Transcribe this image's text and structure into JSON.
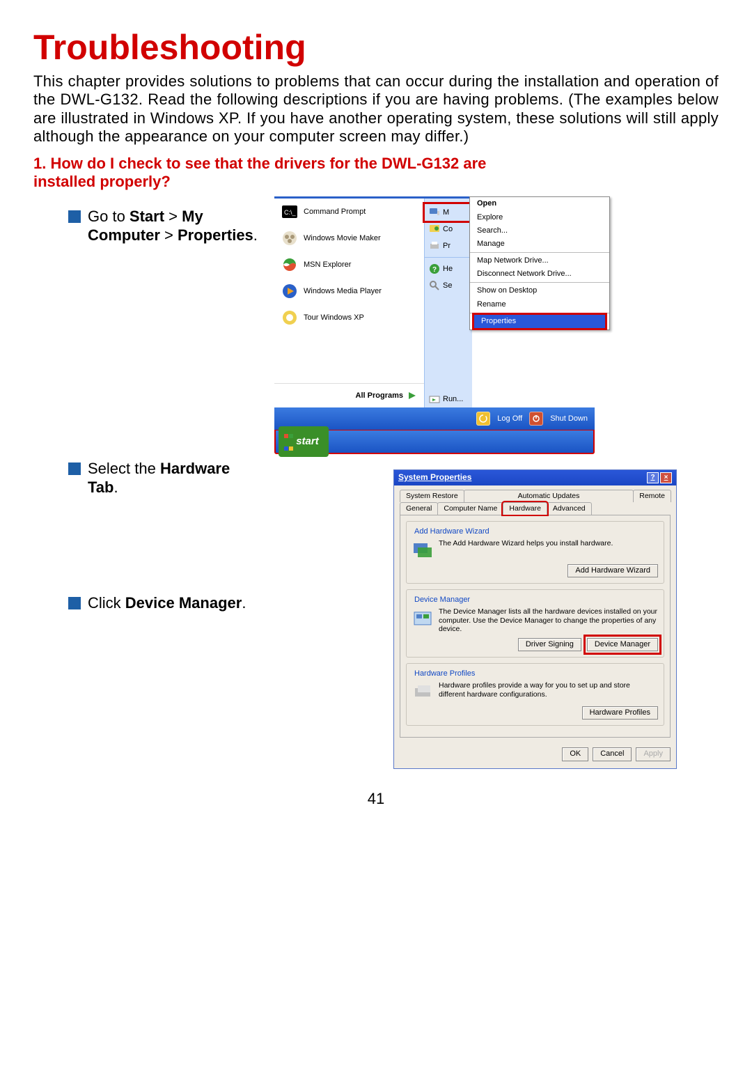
{
  "title": "Troubleshooting",
  "intro": "This chapter provides solutions to problems that can occur during the installation and operation of the DWL-G132. Read the following descriptions if you are having problems. (The examples below are illustrated in Windows XP. If you have another operating system, these solutions will still apply although the appearance on your computer screen may differ.)",
  "question1": "1.  How do I check to see that the drivers for the DWL-G132 are installed properly?",
  "step1_pre": "Go to ",
  "step1_b1": "Start",
  "step1_gt1": " > ",
  "step1_b2": "My Computer",
  "step1_gt2": " > ",
  "step1_b3": "Properties",
  "step1_post": ".",
  "step2_pre": "Select the ",
  "step2_b": "Hardware Tab",
  "step2_post": ".",
  "step3_pre": "Click  ",
  "step3_b": "Device Manager",
  "step3_post": ".",
  "start_menu": {
    "left": [
      "Command Prompt",
      "Windows Movie Maker",
      "MSN Explorer",
      "Windows Media Player",
      "Tour Windows XP"
    ],
    "all_programs": "All Programs",
    "right_short": [
      "M",
      "Co",
      "Pr",
      "He",
      "Se"
    ],
    "right_full_first": "My Computer",
    "run": "Run...",
    "logoff": "Log Off",
    "shutdown": "Shut Down",
    "start": "start"
  },
  "context_menu": {
    "items": [
      "Open",
      "Explore",
      "Search...",
      "Manage",
      "Map Network Drive...",
      "Disconnect Network Drive...",
      "Show on Desktop",
      "Rename",
      "Properties"
    ]
  },
  "sysprop": {
    "title": "System Properties",
    "tabs_row1": [
      "System Restore",
      "Automatic Updates",
      "Remote"
    ],
    "tabs_row2": [
      "General",
      "Computer Name",
      "Hardware",
      "Advanced"
    ],
    "g1_title": "Add Hardware Wizard",
    "g1_text": "The Add Hardware Wizard helps you install hardware.",
    "g1_btn": "Add Hardware Wizard",
    "g2_title": "Device Manager",
    "g2_text": "The Device Manager lists all the hardware devices installed on your computer. Use the Device Manager to change the properties of any device.",
    "g2_btn1": "Driver Signing",
    "g2_btn2": "Device Manager",
    "g3_title": "Hardware Profiles",
    "g3_text": "Hardware profiles provide a way for you to set up and store different hardware configurations.",
    "g3_btn": "Hardware Profiles",
    "ok": "OK",
    "cancel": "Cancel",
    "apply": "Apply"
  },
  "page_number": "41"
}
